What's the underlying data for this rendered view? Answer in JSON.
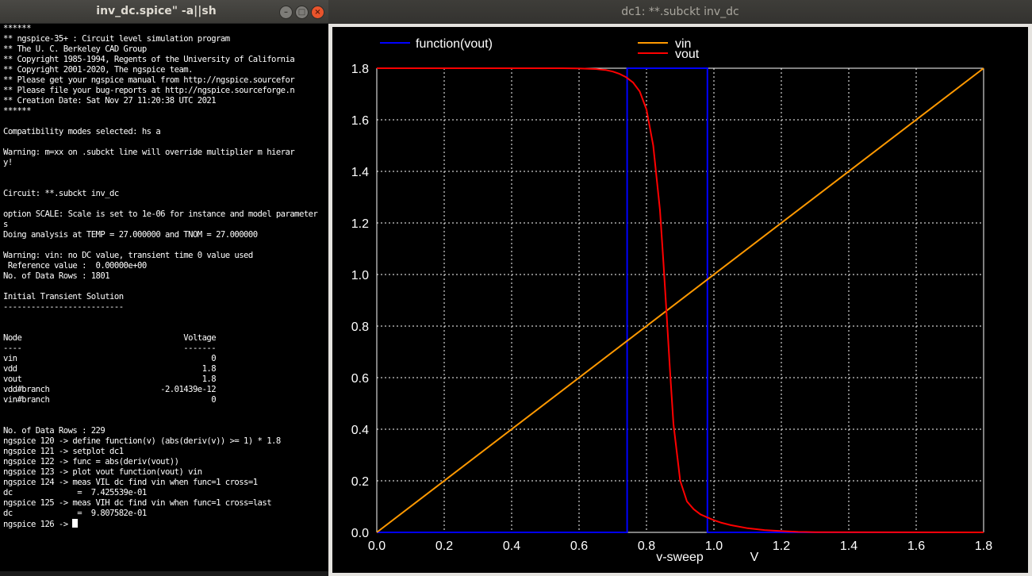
{
  "terminal": {
    "title": "inv_dc.spice\" -a||sh",
    "buttons": {
      "minimize": "–",
      "maximize": "□",
      "close": "×"
    },
    "lines": [
      "******",
      "** ngspice-35+ : Circuit level simulation program",
      "** The U. C. Berkeley CAD Group",
      "** Copyright 1985-1994, Regents of the University of California",
      "** Copyright 2001-2020, The ngspice team.",
      "** Please get your ngspice manual from http://ngspice.sourcefor",
      "** Please file your bug-reports at http://ngspice.sourceforge.n",
      "** Creation Date: Sat Nov 27 11:20:38 UTC 2021",
      "******",
      "",
      "Compatibility modes selected: hs a",
      "",
      "Warning: m=xx on .subckt line will override multiplier m hierar",
      "y!",
      "",
      "",
      "Circuit: **.subckt inv_dc",
      "",
      "option SCALE: Scale is set to 1e-06 for instance and model parameter",
      "s",
      "Doing analysis at TEMP = 27.000000 and TNOM = 27.000000",
      "",
      "Warning: vin: no DC value, transient time 0 value used",
      " Reference value :  0.00000e+00",
      "No. of Data Rows : 1801",
      "",
      "Initial Transient Solution",
      "--------------------------",
      "",
      "",
      "Node                                   Voltage",
      "----                                   -------",
      "vin                                          0",
      "vdd                                        1.8",
      "vout                                       1.8",
      "vdd#branch                        -2.01439e-12",
      "vin#branch                                   0",
      "",
      "",
      "No. of Data Rows : 229",
      "ngspice 120 -> define function(v) (abs(deriv(v)) >= 1) * 1.8",
      "ngspice 121 -> setplot dc1",
      "ngspice 122 -> func = abs(deriv(vout))",
      "ngspice 123 -> plot vout function(vout) vin",
      "ngspice 124 -> meas VIL dc find vin when func=1 cross=1",
      "dc              =  7.425539e-01",
      "ngspice 125 -> meas VIH dc find vin when func=1 cross=last",
      "dc              =  9.807582e-01"
    ],
    "prompt": "ngspice 126 -> "
  },
  "plot": {
    "title": "dc1: **.subckt inv_dc",
    "xlabel": "v-sweep",
    "xunit": "V",
    "colors": {
      "background": "#000000",
      "grid": "#ffffff",
      "function": "#0000ff",
      "vin": "#ff9900",
      "vout": "#ff0000"
    },
    "chart_data": {
      "type": "line",
      "xlim": [
        0,
        1.8
      ],
      "ylim": [
        0,
        1.8
      ],
      "x_ticks": [
        "0.0",
        "0.2",
        "0.4",
        "0.6",
        "0.8",
        "1.0",
        "1.2",
        "1.4",
        "1.6",
        "1.8"
      ],
      "y_ticks": [
        "0.0",
        "0.2",
        "0.4",
        "0.6",
        "0.8",
        "1.0",
        "1.2",
        "1.4",
        "1.6",
        "1.8"
      ],
      "grid": true,
      "legend": [
        "function(vout)",
        "vin",
        "vout"
      ],
      "series": [
        {
          "name": "function(vout)",
          "color": "#0000ff",
          "x": [
            0,
            0.7426,
            0.7426,
            0.9808,
            0.9808,
            1.8
          ],
          "y": [
            0,
            0,
            1.8,
            1.8,
            0,
            0
          ]
        },
        {
          "name": "vin",
          "color": "#ff9900",
          "x": [
            0,
            1.8
          ],
          "y": [
            0,
            1.8
          ]
        },
        {
          "name": "vout",
          "color": "#ff0000",
          "x": [
            0,
            0.55,
            0.6,
            0.65,
            0.68,
            0.7,
            0.72,
            0.74,
            0.76,
            0.78,
            0.8,
            0.82,
            0.84,
            0.85,
            0.86,
            0.87,
            0.88,
            0.9,
            0.92,
            0.94,
            0.96,
            0.98,
            1.0,
            1.02,
            1.05,
            1.1,
            1.15,
            1.2,
            1.25,
            1.3,
            1.8
          ],
          "y": [
            1.8,
            1.8,
            1.799,
            1.797,
            1.793,
            1.787,
            1.778,
            1.765,
            1.745,
            1.71,
            1.64,
            1.5,
            1.25,
            1.05,
            0.84,
            0.62,
            0.42,
            0.2,
            0.12,
            0.09,
            0.07,
            0.058,
            0.047,
            0.038,
            0.028,
            0.016,
            0.009,
            0.005,
            0.002,
            0.001,
            0
          ]
        }
      ]
    }
  }
}
